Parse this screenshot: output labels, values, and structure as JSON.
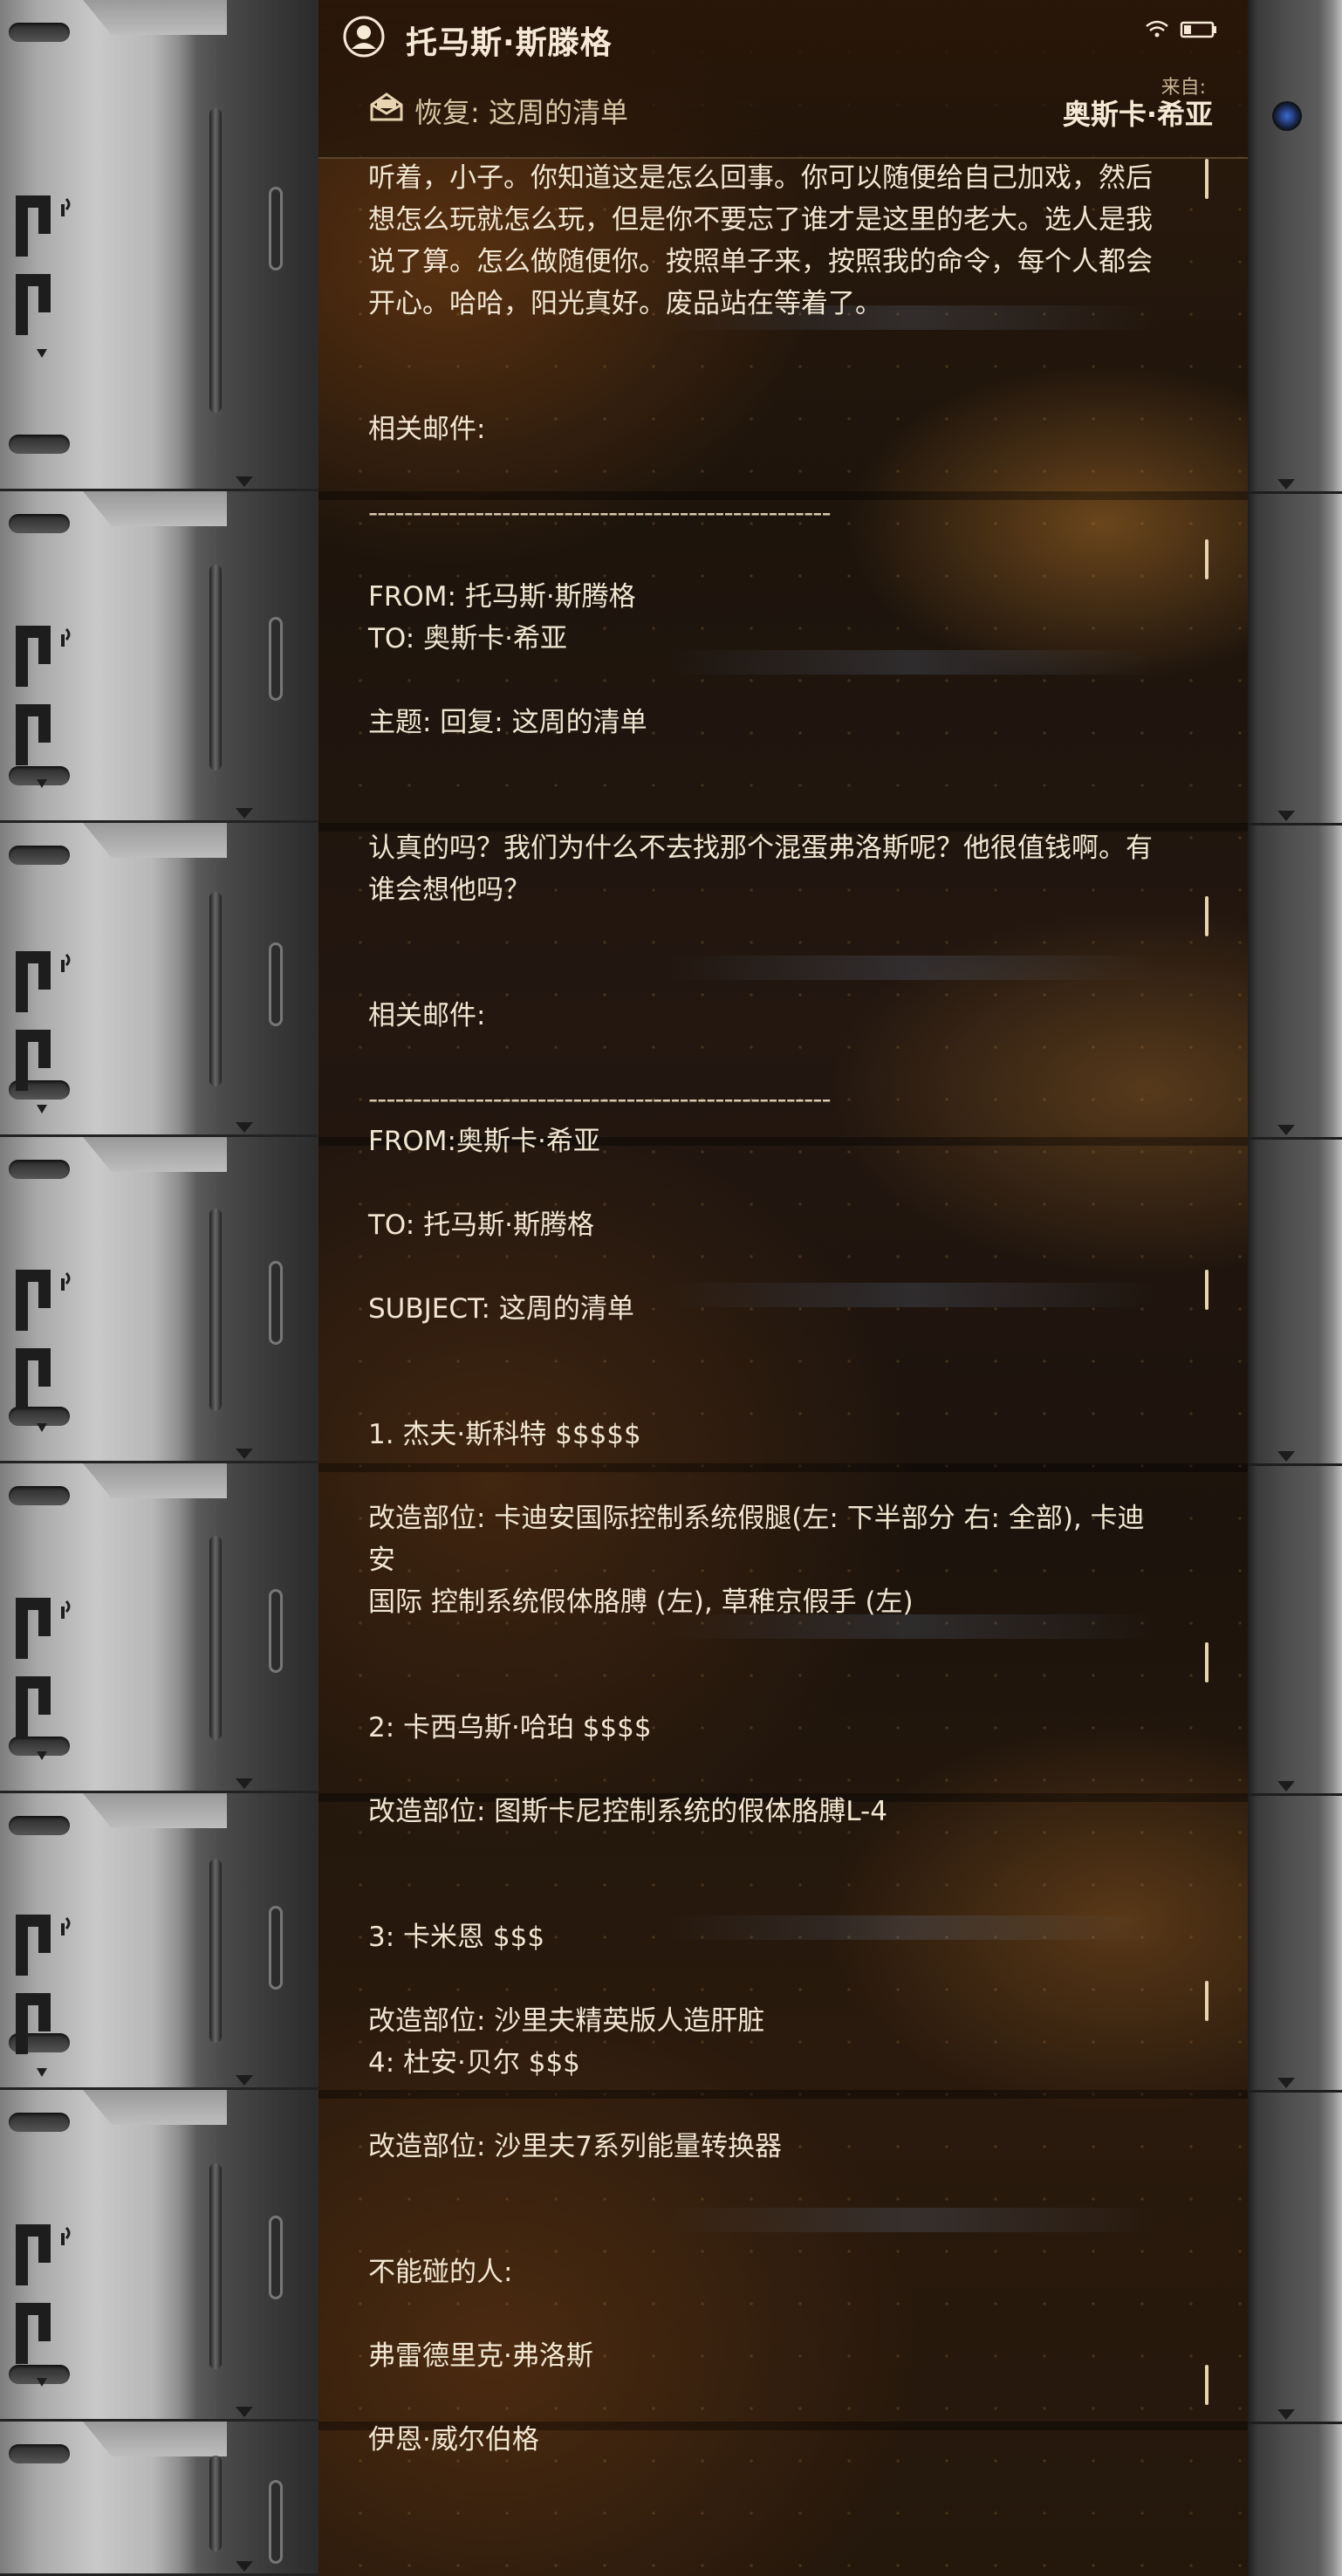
{
  "header": {
    "sender_name": "托马斯·斯滕格",
    "reply_subject": "恢复: 这周的清单",
    "from_label": "来自:",
    "from_name": "奥斯卡·希亚"
  },
  "body_lines": [
    "听着，小子。你知道这是怎么回事。你可以随便给自己加戏，然后",
    "想怎么玩就怎么玩，但是你不要忘了谁才是这里的老大。选人是我",
    "说了算。怎么做随便你。按照单子来，按照我的命令，每个人都会",
    "开心。哈哈，阳光真好。废品站在等着了。",
    "",
    "",
    "相关邮件:",
    "",
    "----------------------------------------------------",
    "",
    "FROM: 托马斯·斯腾格",
    "TO: 奥斯卡·希亚",
    "",
    "主题: 回复: 这周的清单",
    "",
    "",
    "认真的吗？我们为什么不去找那个混蛋弗洛斯呢？他很值钱啊。有",
    "谁会想他吗？",
    "",
    "",
    "相关邮件:",
    "",
    "----------------------------------------------------",
    "FROM:奥斯卡·希亚",
    "",
    "TO: 托马斯·斯腾格",
    "",
    "SUBJECT: 这周的清单",
    "",
    "",
    "1. 杰夫·斯科特 $$$$$",
    "",
    "改造部位: 卡迪安国际控制系统假腿(左: 下半部分 右: 全部), 卡迪安",
    "国际 控制系统假体胳膊 (左), 草稚京假手 (左)",
    "",
    "",
    "2: 卡西乌斯·哈珀 $$$$",
    "",
    "改造部位: 图斯卡尼控制系统的假体胳膊L-4",
    "",
    "",
    "3: 卡米恩 $$$",
    "",
    "改造部位: 沙里夫精英版人造肝脏",
    "4: 杜安·贝尔 $$$",
    "",
    "改造部位: 沙里夫7系列能量转换器",
    "",
    "",
    "不能碰的人:",
    "",
    "弗雷德里克·弗洛斯",
    "",
    "伊恩·威尔伯格"
  ],
  "icons": {
    "avatar": "user-circle-icon",
    "wifi": "wifi-icon",
    "battery": "battery-icon",
    "reply": "open-envelope-icon",
    "camera": "camera-dot"
  },
  "colors": {
    "text": "#f1e6d2",
    "accent": "#e8d4b0",
    "background": "#24170c"
  }
}
